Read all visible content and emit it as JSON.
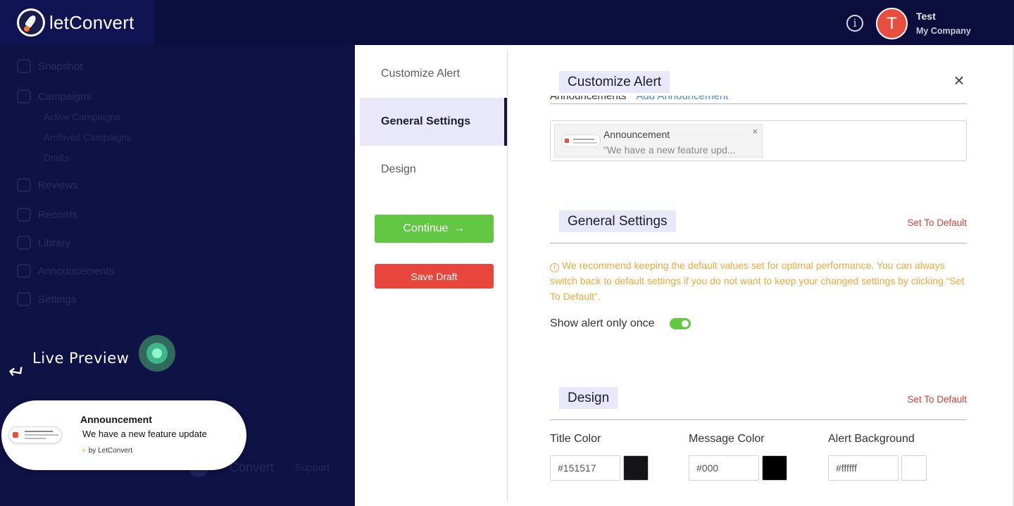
{
  "app": {
    "brand_prefix": "let",
    "brand_suffix": "Convert"
  },
  "user": {
    "initial": "T",
    "name": "Test",
    "company": "My Company"
  },
  "sidebar": {
    "items": [
      "Snapshot",
      "Campaigns",
      "Reviews",
      "Records",
      "Library",
      "Announcements",
      "Settings"
    ],
    "sub_items": [
      "Active Campaigns",
      "Archived Campaigns",
      "Drafts"
    ]
  },
  "background_footer": {
    "brand": "Convert",
    "link": "Support"
  },
  "live_preview": {
    "label": "Live Preview",
    "title": "Announcement",
    "message": "We have a new feature update",
    "powered_by": "by LetConvert"
  },
  "steps": {
    "items": [
      "Customize Alert",
      "General Settings",
      "Design"
    ],
    "active": "General Settings",
    "continue_label": "Continue",
    "save_draft_label": "Save Draft"
  },
  "customize_alert": {
    "title": "Customize Alert",
    "field_label": "Announcements",
    "add_link": "Add Announcement",
    "selected": {
      "name": "Announcement",
      "preview": "\"We have a new feature upd..."
    }
  },
  "general_settings": {
    "title": "General Settings",
    "set_default": "Set To Default",
    "warning": "We recommend keeping the default values set for optimal performance. You can always switch back to default settings if you do not want to keep your changed settings by clicking “Set To Default”.",
    "show_once_label": "Show alert only once",
    "show_once": true
  },
  "design": {
    "title": "Design",
    "set_default": "Set To Default",
    "title_color": {
      "label": "Title Color",
      "value": "#151517",
      "swatch": "#151517"
    },
    "message_color": {
      "label": "Message Color",
      "value": "#000",
      "swatch": "#000000"
    },
    "alert_background": {
      "label": "Alert Background",
      "value": "#ffffff",
      "swatch": "#ffffff"
    }
  },
  "colors": {
    "primary_dark": "#0c0f3d",
    "success": "#62c743",
    "danger": "#e8463c",
    "highlight": "#e9e8fb",
    "warning": "#f0a83a"
  }
}
